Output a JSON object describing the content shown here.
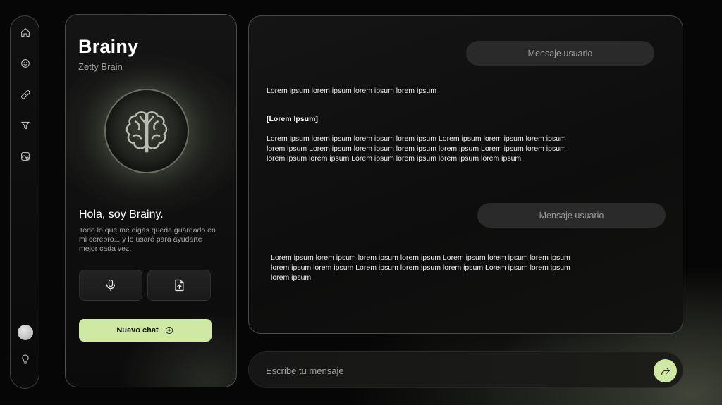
{
  "sidebar": {
    "items": [
      {
        "icon": "home-icon"
      },
      {
        "icon": "smile-icon"
      },
      {
        "icon": "pill-icon"
      },
      {
        "icon": "filter-icon"
      },
      {
        "icon": "photo-settings-icon"
      }
    ],
    "bottom": [
      {
        "icon": "avatar"
      },
      {
        "icon": "lightbulb-icon"
      }
    ]
  },
  "panel": {
    "title": "Brainy",
    "subtitle": "Zetty Brain",
    "orb_icon": "brain-icon",
    "greeting": "Hola, soy Brainy.",
    "description": "Todo lo que me digas queda guardado en mi cerebro... y lo usaré para ayudarte mejor cada vez.",
    "buttons": [
      {
        "icon": "microphone-icon"
      },
      {
        "icon": "upload-file-icon"
      }
    ],
    "new_chat_label": "Nuevo chat",
    "new_chat_icon": "plus-circle-icon"
  },
  "chat": {
    "messages": [
      {
        "role": "user",
        "text": "Mensaje usuario"
      },
      {
        "role": "bot",
        "text": "Lorem ipsum lorem ipsum lorem ipsum lorem ipsum"
      },
      {
        "role": "bot_heading",
        "text": "[Lorem Ipsum]"
      },
      {
        "role": "bot",
        "text": "Lorem ipsum lorem ipsum lorem ipsum lorem ipsum Lorem ipsum lorem ipsum lorem ipsum lorem ipsum Lorem ipsum lorem ipsum lorem ipsum lorem ipsum Lorem ipsum lorem ipsum lorem ipsum lorem ipsum  Lorem ipsum lorem ipsum lorem ipsum lorem ipsum"
      },
      {
        "role": "user",
        "text": "Mensaje usuario"
      },
      {
        "role": "bot",
        "text": "Lorem ipsum lorem ipsum lorem ipsum lorem ipsum Lorem ipsum lorem ipsum lorem ipsum lorem ipsum lorem ipsum Lorem ipsum lorem ipsum lorem ipsum Lorem ipsum lorem ipsum lorem ipsum"
      }
    ]
  },
  "input": {
    "placeholder": "Escribe tu mensaje",
    "value": "",
    "send_icon": "share-arrow-icon"
  },
  "colors": {
    "accent": "#cfe8a3",
    "background": "#060606",
    "bubble": "#2a2a2a"
  }
}
